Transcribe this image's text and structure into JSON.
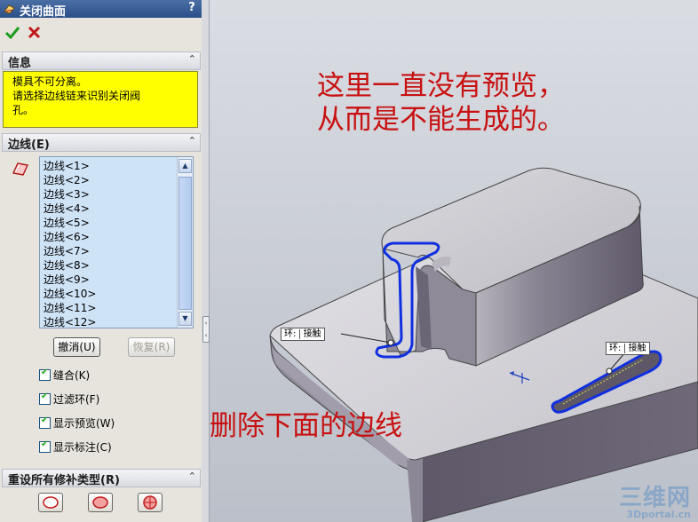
{
  "panel": {
    "title": "关闭曲面",
    "help": "?",
    "info_section": {
      "header": "信息",
      "lines": [
        "模具不可分离。",
        "请选择边线链来识别关闭阀",
        "孔。"
      ]
    },
    "edges_section": {
      "header": "边线(E)",
      "items": [
        "边线<1>",
        "边线<2>",
        "边线<3>",
        "边线<4>",
        "边线<5>",
        "边线<6>",
        "边线<7>",
        "边线<8>",
        "边线<9>",
        "边线<10>",
        "边线<11>",
        "边线<12>"
      ],
      "undo_label": "撤消(U)",
      "redo_label": "恢复(R)",
      "options": [
        {
          "label": "缝合(K)",
          "checked": true
        },
        {
          "label": "过滤环(F)",
          "checked": true
        },
        {
          "label": "显示预览(W)",
          "checked": true
        },
        {
          "label": "显示标注(C)",
          "checked": true
        }
      ]
    },
    "reset_section": {
      "header": "重设所有修补类型(R)"
    }
  },
  "viewport": {
    "annotation_top_line1": "这里一直没有预览，",
    "annotation_top_line2": "从而是不能生成的。",
    "annotation_bottom": "删除下面的边线",
    "tag_left": {
      "a": "环:",
      "b": "接触"
    },
    "tag_right": {
      "a": "环:",
      "b": "接触"
    },
    "watermark_big": "三维网",
    "watermark_small": "3Dportal.cn"
  },
  "colors": {
    "title_bar": "#2b4f87",
    "info_background": "#ffff00",
    "annotation": "#c81010",
    "edge_highlight": "#1030e0"
  }
}
